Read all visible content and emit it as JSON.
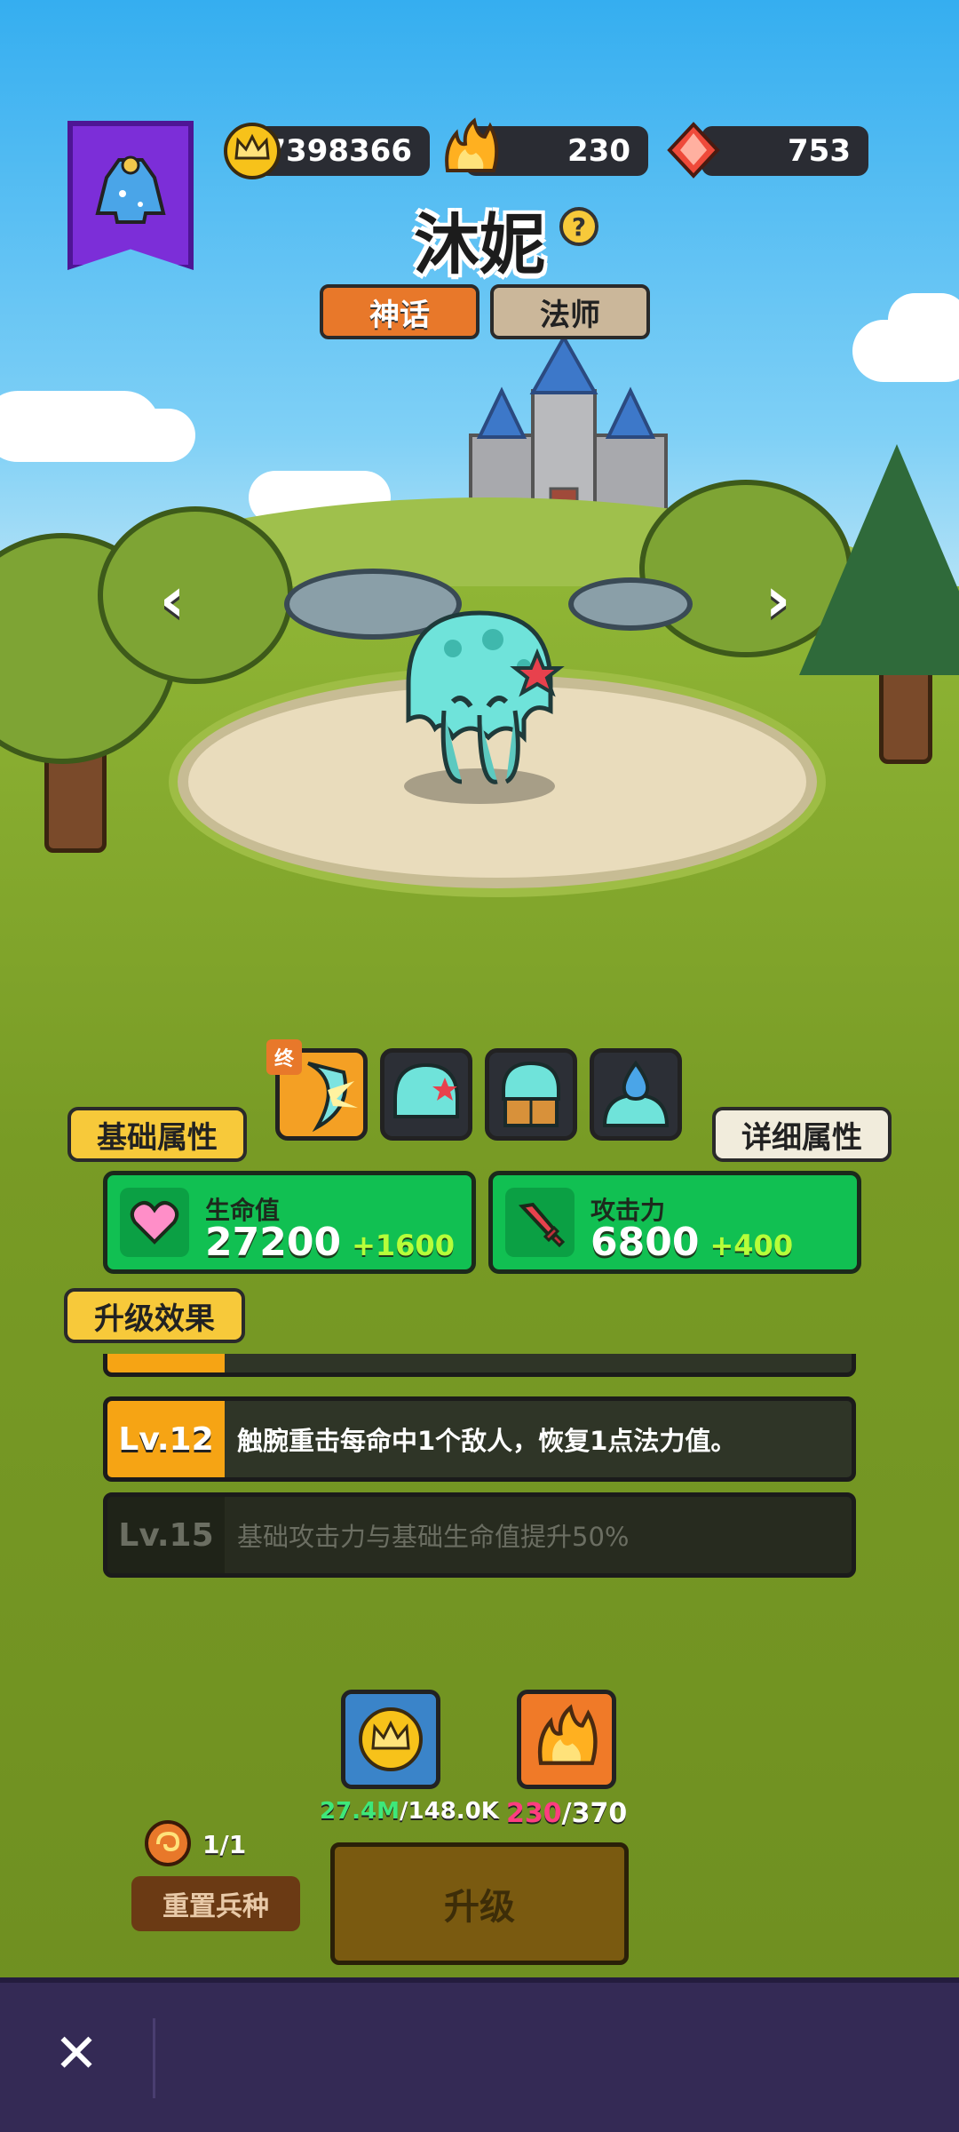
{
  "currencies": {
    "gold": "27398366",
    "fire": "230",
    "gem": "753"
  },
  "hero": {
    "name": "沐妮",
    "help_symbol": "?",
    "tags": [
      "神话",
      "法师"
    ]
  },
  "skills": {
    "ultimate_badge": "终",
    "icons": [
      "moon-slash-skill-icon",
      "jellyfish-skill-icon",
      "jellyfish-reading-skill-icon",
      "water-drop-skill-icon"
    ]
  },
  "tabs": {
    "basic": "基础属性",
    "detail": "详细属性"
  },
  "stats": [
    {
      "label": "生命值",
      "value": "27200",
      "bonus": "+1600",
      "icon": "heart-icon"
    },
    {
      "label": "攻击力",
      "value": "6800",
      "bonus": "+400",
      "icon": "sword-icon"
    }
  ],
  "upgrade_effects": {
    "title": "升级效果",
    "rows": [
      {
        "level": "Lv.12",
        "text": "触腕重击每命中1个敌人，恢复1点法力值。",
        "unlocked": true
      },
      {
        "level": "Lv.15",
        "text": "基础攻击力与基础生命值提升50%",
        "unlocked": false
      }
    ]
  },
  "costs": {
    "gold_have": "27.4M",
    "gold_need": "/148.0K",
    "fire_have": "230",
    "fire_need": "/370"
  },
  "reset": {
    "count": "1/1",
    "label": "重置兵种"
  },
  "upgrade_button": "升级",
  "close_symbol": "✕",
  "colors": {
    "mythic_tag": "#e8782a",
    "class_tag": "#cbb79a",
    "stat_green": "#11c052",
    "level_gold": "#f6a414",
    "gold_amount": "#3ee87a",
    "fire_amount": "#ff3d7f"
  }
}
